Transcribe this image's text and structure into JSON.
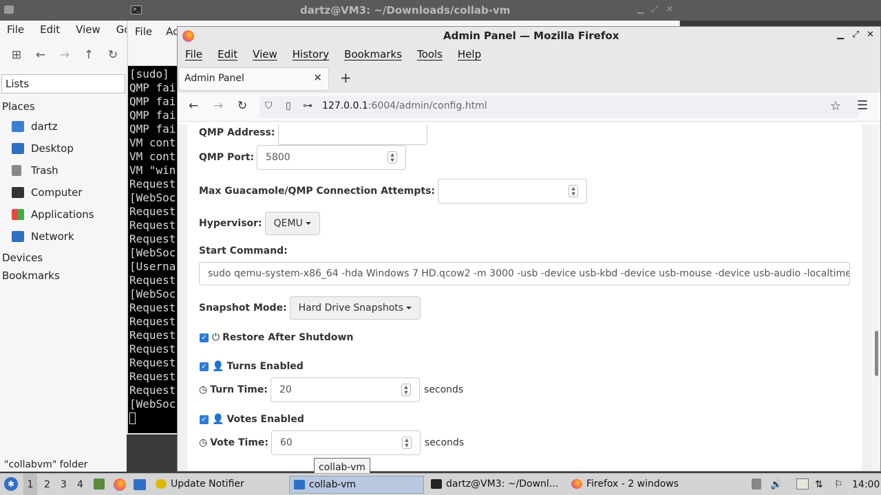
{
  "topbar": {
    "title": "dartz@VM3: ~/Downloads/collab-vm"
  },
  "filemanager": {
    "menu": [
      "File",
      "Edit",
      "View",
      "Go"
    ],
    "lists_label": "Lists",
    "places_heading": "Places",
    "places": [
      "dartz",
      "Desktop",
      "Trash",
      "Computer",
      "Applications",
      "Network"
    ],
    "devices_heading": "Devices",
    "bookmarks_heading": "Bookmarks",
    "status": "\"collabvm\" folder"
  },
  "terminal": {
    "menu": [
      "File",
      "Ac"
    ],
    "lines": [
      "[sudo]",
      "QMP fai",
      "QMP fai",
      "QMP fai",
      "QMP fai",
      "VM cont",
      "VM cont",
      "VM \"win",
      "Request",
      "[WebSoc",
      "Request",
      "Request",
      "Request",
      "[WebSoc",
      "[Userna",
      "Request",
      "[WebSoc",
      "Request",
      "Request",
      "Request",
      "Request",
      "Request",
      "Request",
      "Request",
      "[WebSoc"
    ]
  },
  "firefox": {
    "window_title": "Admin Panel — Mozilla Firefox",
    "menu": [
      "File",
      "Edit",
      "View",
      "History",
      "Bookmarks",
      "Tools",
      "Help"
    ],
    "tab_title": "Admin Panel",
    "url_host": "127.0.0.1",
    "url_path": ":6004/admin/config.html"
  },
  "form": {
    "qmp_address_label": "QMP Address:",
    "qmp_address_value": "",
    "qmp_port_label": "QMP Port:",
    "qmp_port_value": "5800",
    "max_attempts_label": "Max Guacamole/QMP Connection Attempts:",
    "max_attempts_value": "",
    "hypervisor_label": "Hypervisor:",
    "hypervisor_value": "QEMU",
    "start_command_label": "Start Command:",
    "start_command_value": "sudo qemu-system-x86_64 -hda Windows 7 HD.qcow2 -m 3000 -usb -device usb-kbd  -device usb-mouse -device usb-audio -localtime -boot c -netde",
    "snapshot_label": "Snapshot Mode:",
    "snapshot_value": "Hard Drive Snapshots",
    "restore_label": "Restore After Shutdown",
    "restore_checked": true,
    "turns_label": "Turns Enabled",
    "turns_checked": true,
    "turn_time_label": "Turn Time:",
    "turn_time_value": "20",
    "votes_label": "Votes Enabled",
    "votes_checked": true,
    "vote_time_label": "Vote Time:",
    "vote_time_value": "60",
    "seconds": "seconds"
  },
  "tooltip": "collab-vm",
  "taskbar": {
    "workspaces": [
      "1",
      "2",
      "3",
      "4"
    ],
    "tasks": [
      "Update Notifier",
      "collab-vm",
      "dartz@VM3: ~/Downl...",
      "Firefox - 2 windows"
    ],
    "clock": "14:00"
  }
}
